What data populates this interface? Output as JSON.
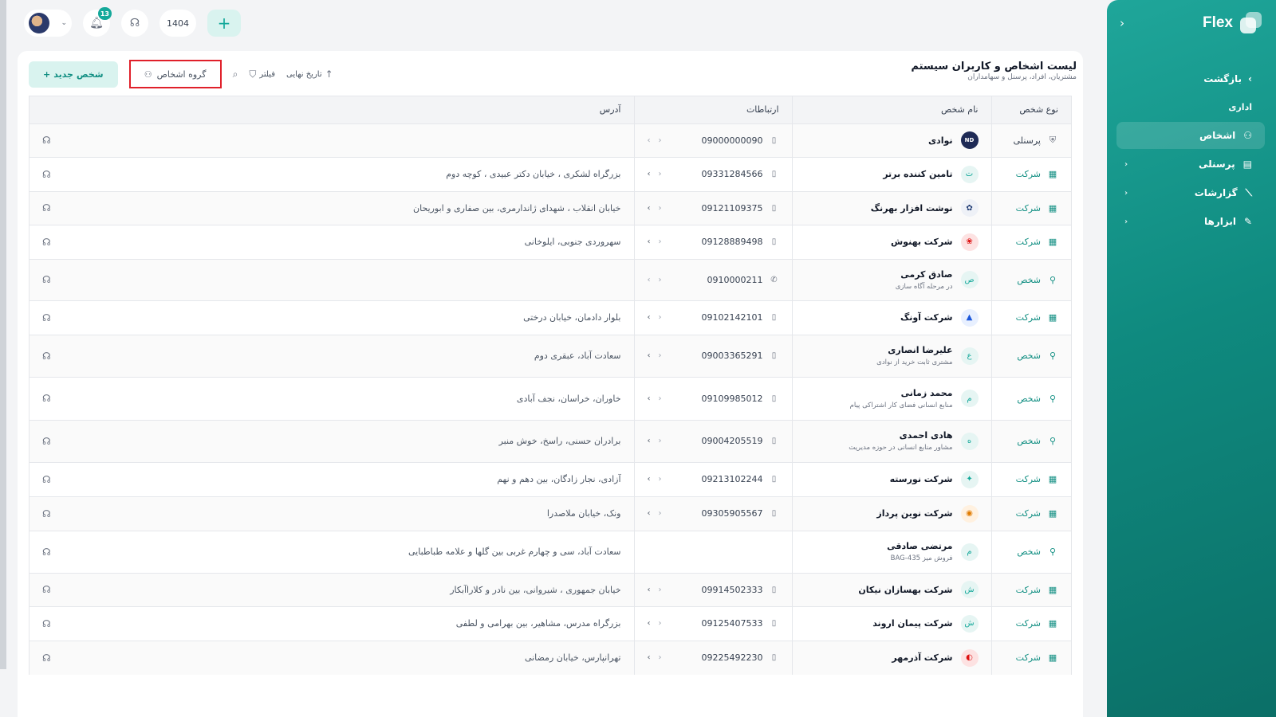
{
  "sidebar": {
    "brand": "Flex",
    "back_label": "بازگشت",
    "section_label": "اداری",
    "items": [
      {
        "label": "اشخاص",
        "icon": "users-icon",
        "active": true
      },
      {
        "label": "پرسنلی",
        "icon": "id-card-icon",
        "active": false
      },
      {
        "label": "گزارشات",
        "icon": "chart-icon",
        "active": false
      },
      {
        "label": "ابزارها",
        "icon": "pencil-icon",
        "active": false
      }
    ]
  },
  "topbar": {
    "notifications_count": "13",
    "year": "1404"
  },
  "page": {
    "title": "لیست اشخاص و کاربران سیستم",
    "subtitle": "مشتریان، افراد، پرسنل و سهامداران",
    "new_person_label": "شخص جدید",
    "group_label": "گروه اشخاص",
    "filter_label": "فیلتر",
    "sort_label": "تاریخ نهایی"
  },
  "table": {
    "headers": {
      "type": "نوع شخص",
      "name": "نام شخص",
      "contact": "ارتباطات",
      "address": "آدرس"
    },
    "rows": [
      {
        "type": "پرسنلی",
        "kind": "staff",
        "name": "نوادی",
        "sub": "",
        "logo": "ND",
        "logo_style": "dark",
        "phone": "09000000090",
        "contact_icon": "mobile",
        "address": "",
        "h": 42
      },
      {
        "type": "شرکت",
        "kind": "company",
        "name": "تامین کننده برتر",
        "sub": "",
        "logo": "ت",
        "logo_style": "",
        "phone": "09331284566",
        "contact_icon": "mobile",
        "address": "بزرگراه لشکری ، خیابان دکتر عبیدی ، کوچه دوم",
        "h": 43
      },
      {
        "type": "شرکت",
        "kind": "company",
        "name": "نوشت افزار بهرنگ",
        "sub": "",
        "logo": "✿",
        "logo_style": "navy",
        "phone": "09121109375",
        "contact_icon": "mobile",
        "address": "خیابان انقلاب ، شهدای ژاندارمری، بین صفاری و ابوریحان",
        "h": 42
      },
      {
        "type": "شرکت",
        "kind": "company",
        "name": "شرکت بهنوش",
        "sub": "",
        "logo": "❀",
        "logo_style": "red",
        "phone": "09128889498",
        "contact_icon": "mobile",
        "address": "سهروردی جنوبی، ایلوخانی",
        "h": 43
      },
      {
        "type": "شخص",
        "kind": "person",
        "name": "صادق کرمی",
        "sub": "در مرحله آگاه سازی",
        "logo": "ص",
        "logo_style": "",
        "phone": "0910000211",
        "contact_icon": "whatsapp",
        "address": "",
        "h": 52
      },
      {
        "type": "شرکت",
        "kind": "company",
        "name": "شرکت آونگ",
        "sub": "",
        "logo": "▲",
        "logo_style": "blue",
        "phone": "09102142101",
        "contact_icon": "mobile",
        "address": "بلوار دادمان، خیابان درختی",
        "h": 43
      },
      {
        "type": "شخص",
        "kind": "person",
        "name": "علیرضا انصاری",
        "sub": "مشتری ثابت خرید از نوادی",
        "logo": "ع",
        "logo_style": "",
        "phone": "09003365291",
        "contact_icon": "mobile",
        "address": "سعادت آباد، عبقری دوم",
        "h": 53
      },
      {
        "type": "شخص",
        "kind": "person",
        "name": "محمد زمانی",
        "sub": "منابع انسانی فضای کار اشتراکی پیام",
        "logo": "م",
        "logo_style": "",
        "phone": "09109985012",
        "contact_icon": "mobile",
        "address": "خاوران، خراسان، نجف آبادی",
        "h": 54
      },
      {
        "type": "شخص",
        "kind": "person",
        "name": "هادی احمدی",
        "sub": "مشاور منابع انسانی در حوزه مدیریت",
        "logo": "ه",
        "logo_style": "",
        "phone": "09004205519",
        "contact_icon": "mobile",
        "address": "برادران حسنی، راسخ، خوش منبر",
        "h": 53
      },
      {
        "type": "شرکت",
        "kind": "company",
        "name": "شرکت نورسته",
        "sub": "",
        "logo": "✦",
        "logo_style": "",
        "phone": "09213102244",
        "contact_icon": "mobile",
        "address": "آزادی، نجار زادگان، بین دهم و نهم",
        "h": 43
      },
      {
        "type": "شرکت",
        "kind": "company",
        "name": "شرکت نوین پرداز",
        "sub": "",
        "logo": "◉",
        "logo_style": "orange",
        "phone": "09305905567",
        "contact_icon": "mobile",
        "address": "ونک، خیابان ملاصدرا",
        "h": 43
      },
      {
        "type": "شخص",
        "kind": "person",
        "name": "مرتضی صادقی",
        "sub": "فروش میز BAG-435",
        "logo": "م",
        "logo_style": "",
        "phone": "",
        "contact_icon": "",
        "address": "سعادت آباد، سی و چهارم غربی بین گلها و علامه طباطبایی",
        "h": 53
      },
      {
        "type": "شرکت",
        "kind": "company",
        "name": "شرکت بهسازان نیکان",
        "sub": "",
        "logo": "ش",
        "logo_style": "",
        "phone": "09914502333",
        "contact_icon": "mobile",
        "address": "خیابان جمهوری ، شیروانی، بین نادر و کلاراآبکار",
        "h": 42
      },
      {
        "type": "شرکت",
        "kind": "company",
        "name": "شرکت پیمان اروند",
        "sub": "",
        "logo": "ش",
        "logo_style": "",
        "phone": "09125407533",
        "contact_icon": "mobile",
        "address": "بزرگراه مدرس، مشاهیر، بین بهرامی و لطفی",
        "h": 43
      },
      {
        "type": "شرکت",
        "kind": "company",
        "name": "شرکت آذرمهر",
        "sub": "",
        "logo": "◐",
        "logo_style": "red",
        "phone": "09225492230",
        "contact_icon": "mobile",
        "address": "تهرانپارس، خیابان رمضانی",
        "h": 43
      }
    ]
  }
}
